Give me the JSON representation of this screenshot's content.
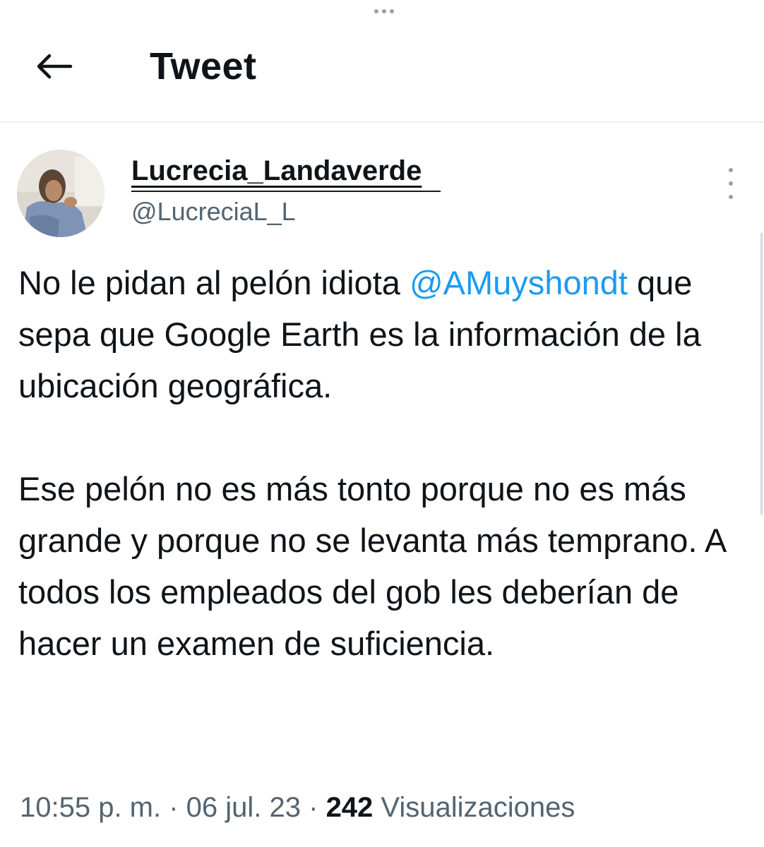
{
  "header": {
    "title": "Tweet"
  },
  "tweet": {
    "author": {
      "display_name": "Lucrecia_Landaverde",
      "handle": "@LucreciaL_L"
    },
    "paragraph1": {
      "text_before": "No le pidan al pelón idiota ",
      "mention": "@AMuyshondt",
      "text_after": " que sepa que Google Earth es la información de la ubicación geográfica."
    },
    "paragraph2": "Ese pelón no es más tonto porque no es más grande y porque no se levanta más temprano. A todos los empleados del gob les deberían de hacer un examen de suficiencia.",
    "meta": {
      "time": "10:55 p. m.",
      "separator": " · ",
      "date": "06 jul. 23",
      "views_count": "242",
      "views_label": " Visualizaciones"
    }
  },
  "colors": {
    "text": "#0f1419",
    "secondary": "#536471",
    "link": "#1d9bf0"
  },
  "icons": {
    "back": "back-arrow-icon",
    "more": "more-vertical-icon"
  }
}
